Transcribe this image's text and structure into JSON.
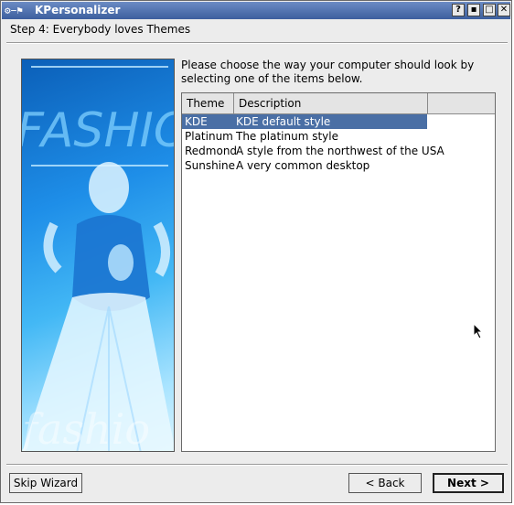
{
  "window": {
    "title": "KPersonalizer",
    "icon_text": "⚙−⚑",
    "controls": {
      "help": "?",
      "minimize": "▪",
      "maximize": "□",
      "close": "✕"
    }
  },
  "step_title": "Step 4: Everybody loves Themes",
  "image": {
    "text_top": "FASHION",
    "text_bottom": "fashio"
  },
  "prompt": "Please choose the way your computer should look by selecting one of the items below.",
  "themes": {
    "columns": [
      "Theme",
      "Description"
    ],
    "rows": [
      {
        "theme": "KDE",
        "description": "KDE default style"
      },
      {
        "theme": "Platinum",
        "description": "The platinum style"
      },
      {
        "theme": "Redmond",
        "description": "A style from the northwest of the USA"
      },
      {
        "theme": "Sunshine",
        "description": "A very common desktop"
      }
    ],
    "selected": "KDE"
  },
  "buttons": {
    "skip": "Skip Wizard",
    "back": "< Back",
    "next": "Next >"
  },
  "colors": {
    "titlebar": "#4a6fa5",
    "selection": "#4a6fa5",
    "window_bg": "#ececec"
  }
}
